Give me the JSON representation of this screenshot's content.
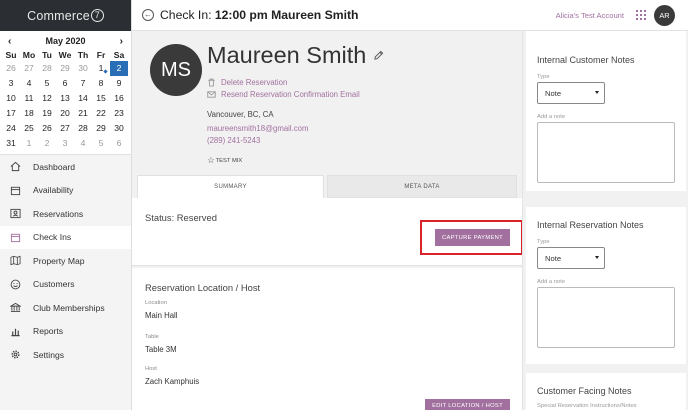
{
  "brand": {
    "name": "Commerce",
    "mark": "7"
  },
  "calendar": {
    "prev": "‹",
    "next": "›",
    "month_label": "May 2020",
    "weekdays": [
      "Su",
      "Mo",
      "Tu",
      "We",
      "Th",
      "Fr",
      "Sa"
    ],
    "weeks": [
      [
        "26",
        "27",
        "28",
        "29",
        "30",
        "1",
        "2"
      ],
      [
        "3",
        "4",
        "5",
        "6",
        "7",
        "8",
        "9"
      ],
      [
        "10",
        "11",
        "12",
        "13",
        "14",
        "15",
        "16"
      ],
      [
        "17",
        "18",
        "19",
        "20",
        "21",
        "22",
        "23"
      ],
      [
        "24",
        "25",
        "26",
        "27",
        "28",
        "29",
        "30"
      ],
      [
        "31",
        "1",
        "2",
        "3",
        "4",
        "5",
        "6"
      ]
    ],
    "selected_color": "#2a6fb5"
  },
  "nav": {
    "items": [
      {
        "label": "Dashboard",
        "icon": "house-icon"
      },
      {
        "label": "Availability",
        "icon": "calendar-icon"
      },
      {
        "label": "Reservations",
        "icon": "id-card-icon"
      },
      {
        "label": "Check Ins",
        "icon": "calendar-check-icon",
        "active": true
      },
      {
        "label": "Property Map",
        "icon": "map-icon"
      },
      {
        "label": "Customers",
        "icon": "smiley-icon"
      },
      {
        "label": "Club Memberships",
        "icon": "building-icon"
      },
      {
        "label": "Reports",
        "icon": "bar-chart-icon"
      },
      {
        "label": "Settings",
        "icon": "gear-icon"
      }
    ]
  },
  "header": {
    "title_prefix": "Check In: ",
    "title_bold": "12:00 pm Maureen Smith",
    "account": "Alicia's Test Account",
    "avatar_initials": "AR"
  },
  "profile": {
    "initials": "MS",
    "name": "Maureen Smith",
    "delete_reservation": "Delete Reservation",
    "resend_confirmation": "Resend Reservation Confirmation Email",
    "location": "Vancouver, BC, CA",
    "email": "maureensmith18@gmail.com",
    "phone": "(289) 241-5243",
    "tag": "TEST MIX"
  },
  "tabs": {
    "summary": "SUMMARY",
    "meta_data": "META DATA"
  },
  "summary": {
    "status": "Status: Reserved",
    "capture_payment": "CAPTURE PAYMENT"
  },
  "location_host": {
    "title": "Reservation Location / Host",
    "location_label": "Location",
    "location_value": "Main Hall",
    "table_label": "Table",
    "table_value": "Table 3M",
    "host_label": "Host",
    "host_value": "Zach Kamphuis",
    "edit_button": "EDIT LOCATION / HOST"
  },
  "notes": {
    "internal_customer": {
      "title": "Internal Customer Notes",
      "type_label": "Type",
      "type_value": "Note",
      "add_label": "Add a note"
    },
    "internal_reservation": {
      "title": "Internal Reservation Notes",
      "type_label": "Type",
      "type_value": "Note",
      "add_label": "Add a note"
    },
    "customer_facing": {
      "title": "Customer Facing Notes",
      "sub_label": "Special Reservation Instructions/Notes"
    }
  },
  "colors": {
    "accent": "#a2709f",
    "dark": "#2b2f33",
    "highlight": "#d9232b"
  }
}
